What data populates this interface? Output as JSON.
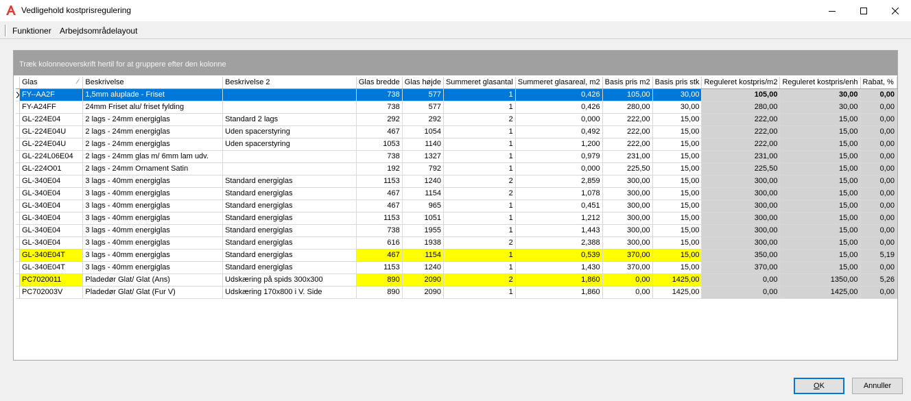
{
  "window": {
    "title": "Vedligehold kostprisregulering"
  },
  "menu": {
    "items": [
      "Funktioner",
      "Arbejdsområdelayout"
    ]
  },
  "grid": {
    "group_hint": "Træk kolonneoverskrift hertil for at gruppere efter den kolonne",
    "columns": [
      "Glas",
      "Beskrivelse",
      "Beskrivelse 2",
      "Glas bredde",
      "Glas højde",
      "Summeret glasantal",
      "Summeret glasareal, m2",
      "Basis pris m2",
      "Basis pris stk",
      "Reguleret kostpris/m2",
      "Reguleret kostpris/enh",
      "Rabat, %"
    ],
    "sorted_column": "Glas",
    "colors": {
      "selection": "#0078d7",
      "highlight": "#ffff00",
      "calculated": "#d3d3d3"
    },
    "rows": [
      {
        "cells": [
          "FY--AA2F",
          "1,5mm aluplade - Friset",
          "",
          "738",
          "577",
          "1",
          "0,426",
          "105,00",
          "30,00",
          "105,00",
          "30,00",
          "0,00"
        ],
        "selected": true,
        "highlight": false
      },
      {
        "cells": [
          "FY-A24FF",
          "24mm Friset alu/ friset fylding",
          "",
          "738",
          "577",
          "1",
          "0,426",
          "280,00",
          "30,00",
          "280,00",
          "30,00",
          "0,00"
        ],
        "selected": false,
        "highlight": false
      },
      {
        "cells": [
          "GL-224E04",
          "2 lags - 24mm energiglas",
          "Standard 2 lags",
          "292",
          "292",
          "2",
          "0,000",
          "222,00",
          "15,00",
          "222,00",
          "15,00",
          "0,00"
        ],
        "selected": false,
        "highlight": false
      },
      {
        "cells": [
          "GL-224E04U",
          "2 lags - 24mm energiglas",
          "Uden spacerstyring",
          "467",
          "1054",
          "1",
          "0,492",
          "222,00",
          "15,00",
          "222,00",
          "15,00",
          "0,00"
        ],
        "selected": false,
        "highlight": false
      },
      {
        "cells": [
          "GL-224E04U",
          "2 lags - 24mm energiglas",
          "Uden spacerstyring",
          "1053",
          "1140",
          "1",
          "1,200",
          "222,00",
          "15,00",
          "222,00",
          "15,00",
          "0,00"
        ],
        "selected": false,
        "highlight": false
      },
      {
        "cells": [
          "GL-224L06E04",
          "2 lags - 24mm glas m/ 6mm lam udv.",
          "",
          "738",
          "1327",
          "1",
          "0,979",
          "231,00",
          "15,00",
          "231,00",
          "15,00",
          "0,00"
        ],
        "selected": false,
        "highlight": false
      },
      {
        "cells": [
          "GL-224O01",
          "2 lags - 24mm  Ornament Satin",
          "",
          "192",
          "792",
          "1",
          "0,000",
          "225,50",
          "15,00",
          "225,50",
          "15,00",
          "0,00"
        ],
        "selected": false,
        "highlight": false
      },
      {
        "cells": [
          "GL-340E04",
          "3 lags - 40mm energiglas",
          "Standard energiglas",
          "1153",
          "1240",
          "2",
          "2,859",
          "300,00",
          "15,00",
          "300,00",
          "15,00",
          "0,00"
        ],
        "selected": false,
        "highlight": false
      },
      {
        "cells": [
          "GL-340E04",
          "3 lags - 40mm energiglas",
          "Standard energiglas",
          "467",
          "1154",
          "2",
          "1,078",
          "300,00",
          "15,00",
          "300,00",
          "15,00",
          "0,00"
        ],
        "selected": false,
        "highlight": false
      },
      {
        "cells": [
          "GL-340E04",
          "3 lags - 40mm energiglas",
          "Standard energiglas",
          "467",
          "965",
          "1",
          "0,451",
          "300,00",
          "15,00",
          "300,00",
          "15,00",
          "0,00"
        ],
        "selected": false,
        "highlight": false
      },
      {
        "cells": [
          "GL-340E04",
          "3 lags - 40mm energiglas",
          "Standard energiglas",
          "1153",
          "1051",
          "1",
          "1,212",
          "300,00",
          "15,00",
          "300,00",
          "15,00",
          "0,00"
        ],
        "selected": false,
        "highlight": false
      },
      {
        "cells": [
          "GL-340E04",
          "3 lags - 40mm energiglas",
          "Standard energiglas",
          "738",
          "1955",
          "1",
          "1,443",
          "300,00",
          "15,00",
          "300,00",
          "15,00",
          "0,00"
        ],
        "selected": false,
        "highlight": false
      },
      {
        "cells": [
          "GL-340E04",
          "3 lags - 40mm energiglas",
          "Standard energiglas",
          "616",
          "1938",
          "2",
          "2,388",
          "300,00",
          "15,00",
          "300,00",
          "15,00",
          "0,00"
        ],
        "selected": false,
        "highlight": false
      },
      {
        "cells": [
          "GL-340E04T",
          "3 lags - 40mm energiglas",
          "Standard energiglas",
          "467",
          "1154",
          "1",
          "0,539",
          "370,00",
          "15,00",
          "350,00",
          "15,00",
          "5,19"
        ],
        "selected": false,
        "highlight": true
      },
      {
        "cells": [
          "GL-340E04T",
          "3 lags - 40mm energiglas",
          "Standard energiglas",
          "1153",
          "1240",
          "1",
          "1,430",
          "370,00",
          "15,00",
          "370,00",
          "15,00",
          "0,00"
        ],
        "selected": false,
        "highlight": false
      },
      {
        "cells": [
          "PC7020011",
          "Pladedør Glat/ Glat (Ans)",
          "Udskæring på spids 300x300",
          "890",
          "2090",
          "2",
          "1,860",
          "0,00",
          "1425,00",
          "0,00",
          "1350,00",
          "5,26"
        ],
        "selected": false,
        "highlight": true
      },
      {
        "cells": [
          "PC702003V",
          "Pladedør Glat/ Glat (Fur V)",
          "Udskæring 170x800 i V. Side",
          "890",
          "2090",
          "1",
          "1,860",
          "0,00",
          "1425,00",
          "0,00",
          "1425,00",
          "0,00"
        ],
        "selected": false,
        "highlight": false
      }
    ]
  },
  "buttons": {
    "ok_mnemonic": "O",
    "ok_rest": "K",
    "cancel": "Annuller"
  }
}
